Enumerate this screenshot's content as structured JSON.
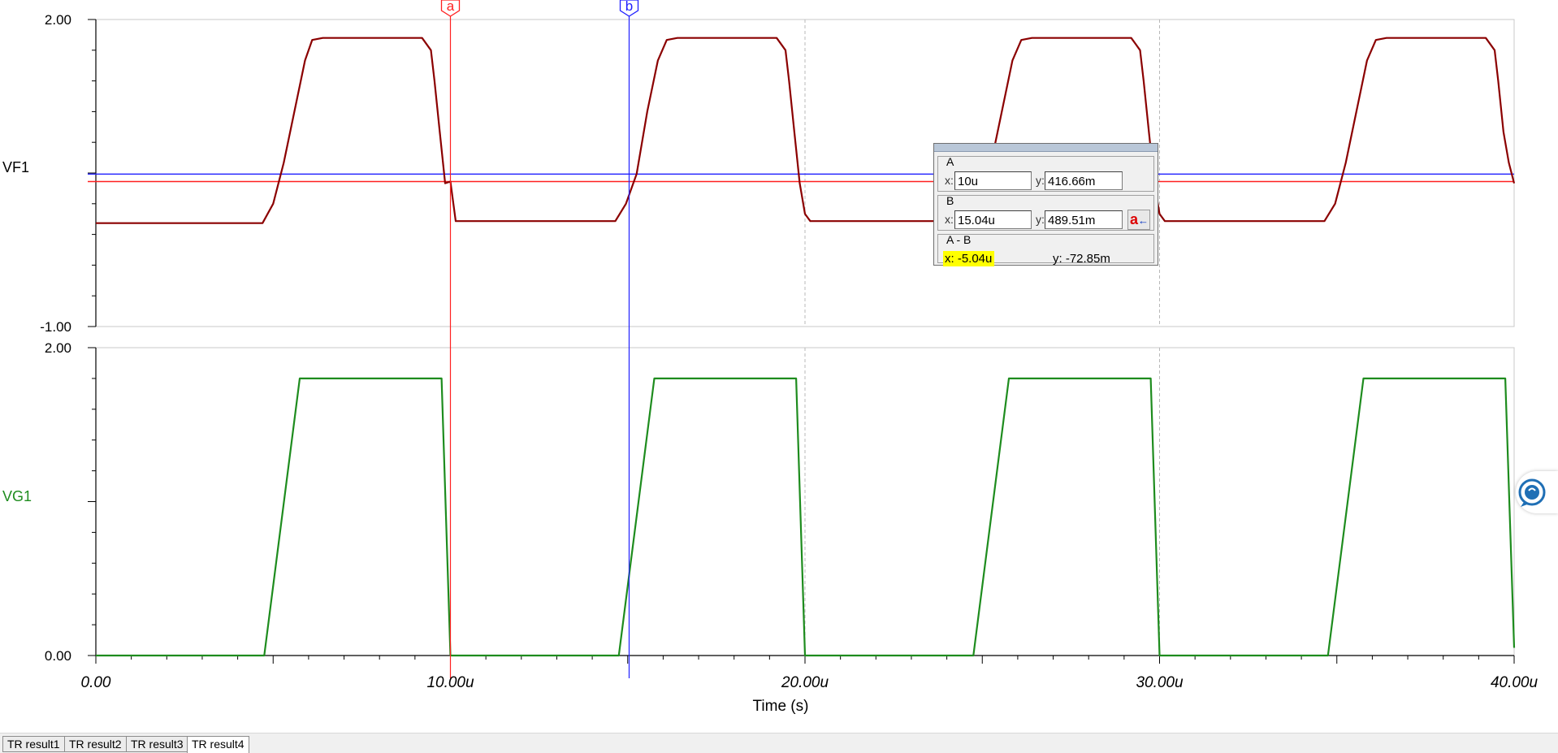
{
  "chart_data": [
    {
      "type": "line",
      "name_label": "VF1",
      "ylim": [
        -1.0,
        2.0
      ],
      "ytick_labels": [
        "2.00",
        "-1.00"
      ],
      "xlim": [
        0,
        40
      ],
      "series": [
        {
          "name": "VF1",
          "color": "#8b0000",
          "x": [
            0,
            4.7,
            5.0,
            5.3,
            5.6,
            5.9,
            6.1,
            6.4,
            9.2,
            9.45,
            9.55,
            9.7,
            9.85,
            10.0,
            10.15,
            14.65,
            14.95,
            15.25,
            15.55,
            15.85,
            16.1,
            16.4,
            19.2,
            19.45,
            19.55,
            19.7,
            19.85,
            20.0,
            20.15,
            24.65,
            24.95,
            25.25,
            25.55,
            25.85,
            26.1,
            26.4,
            29.2,
            29.45,
            29.55,
            29.7,
            29.85,
            30.0,
            30.15,
            34.65,
            34.95,
            35.25,
            35.55,
            35.85,
            36.1,
            36.4,
            39.2,
            39.45,
            39.55,
            39.7,
            39.85,
            40.0
          ],
          "y": [
            0.01,
            0.01,
            0.2,
            0.6,
            1.1,
            1.6,
            1.8,
            1.82,
            1.82,
            1.7,
            1.4,
            0.9,
            0.4,
            0.4167,
            0.03,
            0.03,
            0.2,
            0.4895,
            1.1,
            1.6,
            1.8,
            1.82,
            1.82,
            1.7,
            1.4,
            0.9,
            0.4,
            0.1,
            0.03,
            0.03,
            0.2,
            0.6,
            1.1,
            1.6,
            1.8,
            1.82,
            1.82,
            1.7,
            1.4,
            0.9,
            0.4,
            0.1,
            0.03,
            0.03,
            0.2,
            0.6,
            1.1,
            1.6,
            1.8,
            1.82,
            1.82,
            1.7,
            1.4,
            0.9,
            0.6,
            0.4
          ]
        }
      ]
    },
    {
      "type": "line",
      "name_label": "VG1",
      "ylim": [
        0.0,
        2.0
      ],
      "ytick_labels": [
        "2.00",
        "0.00"
      ],
      "xlim": [
        0,
        40
      ],
      "xtick_labels": [
        "0.00",
        "10.00u",
        "20.00u",
        "30.00u",
        "40.00u"
      ],
      "xtick_values": [
        0,
        10,
        20,
        30,
        40
      ],
      "xlabel": "Time (s)",
      "series": [
        {
          "name": "VG1",
          "color": "#1e8c1e",
          "x": [
            0,
            4.75,
            5.75,
            9.75,
            10.0,
            14.75,
            15.75,
            19.75,
            20.0,
            24.75,
            25.75,
            29.75,
            30.0,
            34.75,
            35.75,
            39.75,
            40.0
          ],
          "y": [
            0,
            0,
            1.8,
            1.8,
            0,
            0,
            1.8,
            1.8,
            0,
            0,
            1.8,
            1.8,
            0,
            0,
            1.8,
            1.8,
            0.05
          ]
        }
      ]
    }
  ],
  "cursors": {
    "a": {
      "label": "a",
      "x": 10.0,
      "color": "#ff2020",
      "level": 0.4167
    },
    "b": {
      "label": "b",
      "x": 15.04,
      "color": "#2020ff",
      "level": 0.4895
    }
  },
  "cursor_panel": {
    "a_label": "A",
    "b_label": "B",
    "diff_label": "A - B",
    "x_axis_letter": "x:",
    "y_axis_letter": "y:",
    "a_x": "10u",
    "a_y": "416.66m",
    "b_x": "15.04u",
    "b_y": "489.51m",
    "swap_label": "a",
    "swap_arrow": "←",
    "diff_x": "x:  -5.04u",
    "diff_y": "y: -72.85m"
  },
  "tabs": [
    {
      "label": "TR result1",
      "active": false
    },
    {
      "label": "TR result2",
      "active": false
    },
    {
      "label": "TR result3",
      "active": false
    },
    {
      "label": "TR result4",
      "active": true
    }
  ],
  "side_button_icon": "chat-assistant-icon"
}
